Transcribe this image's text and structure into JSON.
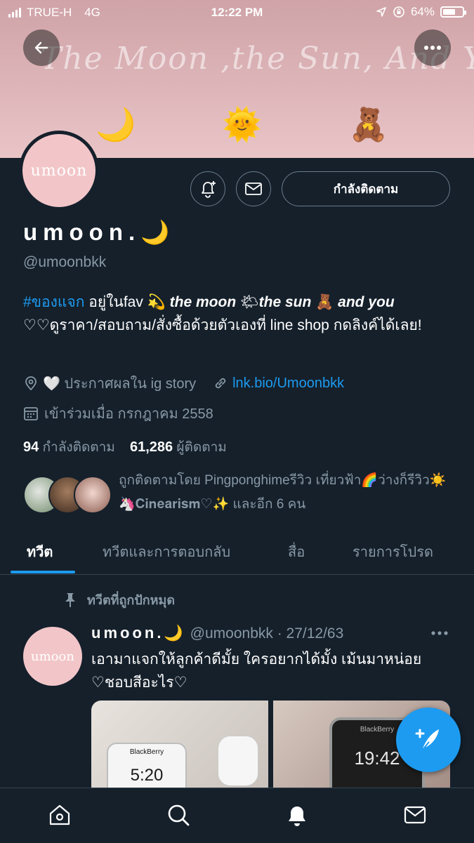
{
  "status_bar": {
    "carrier": "TRUE-H",
    "network": "4G",
    "time": "12:22 PM",
    "battery_percent_label": "64%",
    "battery_level": 0.64
  },
  "banner": {
    "script_title": "The Moon ,the Sun, And You",
    "emojis": [
      "🌙",
      "🌞",
      "🧸"
    ]
  },
  "profile": {
    "avatar_text": "umoon",
    "display_name": "umoon.🌙",
    "handle": "@umoonbkk",
    "following_button": "กำลังติดตาม",
    "bio": {
      "hashtag": "#ของแจก",
      "part1": " อยู่ในfav 💫",
      "moon": "the moon",
      "sun_emoji": " 🌤",
      "sun": "the sun",
      "bear_emoji": " 🧸 ",
      "you": "and you",
      "line2": "♡♡ดูราคา/สอบถาม/สั่งซื้อด้วยตัวเองที่ line shop กดลิงค์ได้เลย!"
    },
    "location": "🤍 ประกาศผลใน ig story",
    "link": "lnk.bio/Umoonbkk",
    "joined": "เข้าร่วมเมื่อ กรกฎาคม 2558",
    "following_count": "94",
    "following_label": "กำลังติดตาม",
    "followers_count": "61,286",
    "followers_label": "ผู้ติดตาม",
    "followed_by": "ถูกติดตามโดย Pingponghimeรีวิว เที่ยวฟ้า🌈ว่างก็รีวิว☀️ 🦄𝐂𝐢𝐧𝐞𝐚𝐫𝐢𝐬𝐦♡✨ และอีก 6 คน"
  },
  "tabs": [
    {
      "label": "ทวีต",
      "active": true
    },
    {
      "label": "ทวีตและการตอบกลับ",
      "active": false
    },
    {
      "label": "สื่อ",
      "active": false
    },
    {
      "label": "รายการโปรด",
      "active": false
    }
  ],
  "pinned": {
    "label": "ทวีตที่ถูกปักหมุด",
    "author": "umoon.🌙",
    "handle_date": "@umoonbkk · 27/12/63",
    "avatar_text": "umoon",
    "text": "เอามาแจกให้ลูกค้าดีมั้ย ใครอยากได้มั้ง เม้นมาหน่อย ♡ชอบสีอะไร♡",
    "media": [
      {
        "brand": "BlackBerry",
        "time": "5:20"
      },
      {
        "brand": "BlackBerry",
        "time": "19:42"
      }
    ]
  },
  "fab_label": "+",
  "icons": {
    "back": "back-arrow-icon",
    "more": "more-icon",
    "notify": "bell-plus-icon",
    "message": "envelope-icon",
    "location": "location-pin-icon",
    "link": "link-icon",
    "calendar": "calendar-icon",
    "pin": "pin-icon",
    "nav": [
      "home-icon",
      "search-icon",
      "bell-icon",
      "mail-icon"
    ]
  }
}
